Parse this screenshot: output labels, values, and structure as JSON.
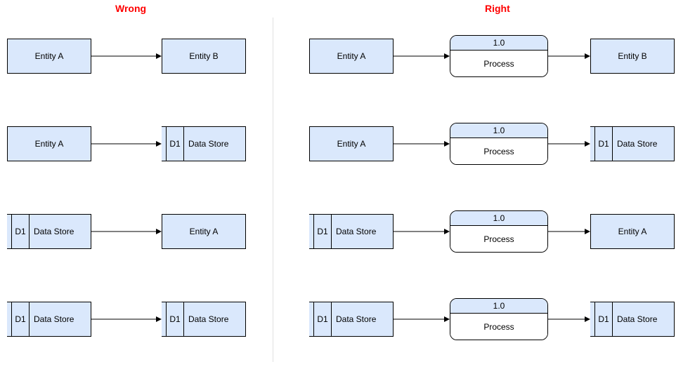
{
  "headings": {
    "wrong": "Wrong",
    "right": "Right"
  },
  "labels": {
    "entityA": "Entity A",
    "entityB": "Entity B",
    "dsId": "D1",
    "dsName": "Data Store",
    "procId": "1.0",
    "procName": "Process"
  },
  "rows": {
    "wrong": [
      {
        "left": "entity:A",
        "right": "entity:B"
      },
      {
        "left": "entity:A",
        "right": "datastore"
      },
      {
        "left": "datastore",
        "right": "entity:A"
      },
      {
        "left": "datastore",
        "right": "datastore"
      }
    ],
    "right": [
      {
        "left": "entity:A",
        "mid": "process",
        "right": "entity:B"
      },
      {
        "left": "entity:A",
        "mid": "process",
        "right": "datastore"
      },
      {
        "left": "datastore",
        "mid": "process",
        "right": "entity:A"
      },
      {
        "left": "datastore",
        "mid": "process",
        "right": "datastore"
      }
    ]
  }
}
